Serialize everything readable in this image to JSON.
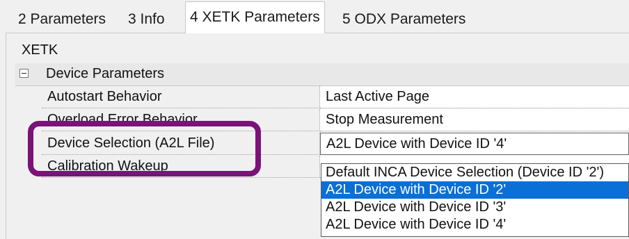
{
  "tabs": [
    {
      "label": "2 Parameters",
      "active": false
    },
    {
      "label": "3 Info",
      "active": false
    },
    {
      "label": "4 XETK Parameters",
      "active": true
    },
    {
      "label": "5 ODX Parameters",
      "active": false
    }
  ],
  "category": "XETK",
  "group": {
    "label": "Device Parameters",
    "expander": "minus-box-icon"
  },
  "properties": [
    {
      "name": "Autostart Behavior",
      "value": "Last Active Page"
    },
    {
      "name": "Overload Error Behavior",
      "value": "Stop Measurement"
    },
    {
      "name": "Device Selection (A2L File)",
      "value": "A2L Device with Device ID '4'"
    },
    {
      "name": "Calibration Wakeup",
      "value": ""
    }
  ],
  "dropdown": {
    "options": [
      "Default INCA Device Selection (Device ID '2')",
      "A2L Device with Device ID '2'",
      "A2L Device with Device ID '3'",
      "A2L Device with Device ID '4'"
    ],
    "highlighted_index": 1
  },
  "annotation": {
    "color": "#7a1278",
    "shape": "rounded-rectangle"
  },
  "colors": {
    "selection": "#0a6fd6",
    "highlight_outline": "#7a1278"
  }
}
